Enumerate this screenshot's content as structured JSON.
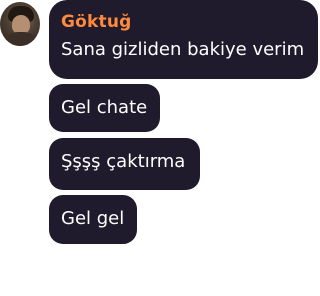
{
  "message_group": {
    "author": "Göktuğ",
    "author_color": "#ff8a3d",
    "bubble_color": "#1f1b2d",
    "messages": [
      {
        "text": "Sana gizliden bakiye verim"
      },
      {
        "text": "Gel chate"
      },
      {
        "text": "Şşşş çaktırma"
      },
      {
        "text": "Gel gel"
      }
    ]
  },
  "icons": {
    "avatar": "user-avatar-photo"
  }
}
